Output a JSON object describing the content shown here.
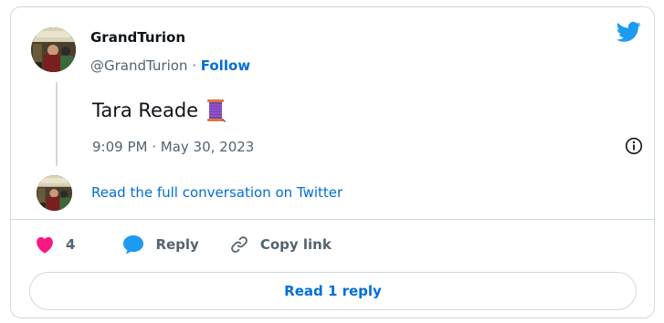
{
  "author": {
    "display_name": "GrandTurion",
    "handle": "@GrandTurion",
    "separator": " · ",
    "follow_label": "Follow"
  },
  "tweet": {
    "text": "Tara Reade",
    "emoji": "spool-of-thread",
    "timestamp": "9:09 PM · May 30, 2023"
  },
  "conversation_link": "Read the full conversation on Twitter",
  "actions": {
    "likes_count": "4",
    "reply_label": "Reply",
    "copy_link_label": "Copy link"
  },
  "read_replies_label": "Read 1 reply",
  "colors": {
    "link_blue": "#006fd6",
    "twitter_blue": "#1d9bf0",
    "heart_red": "#f91880",
    "muted_text": "#536471",
    "border": "#cfd9de"
  },
  "icons": [
    "twitter-logo-icon",
    "info-icon",
    "heart-icon",
    "reply-bubble-icon",
    "link-icon"
  ]
}
